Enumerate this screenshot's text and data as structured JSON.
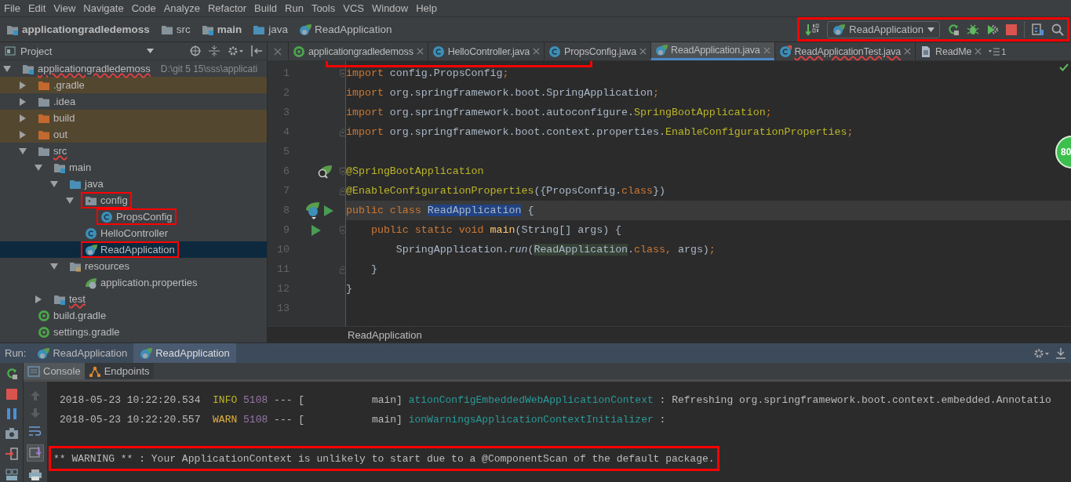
{
  "menu": [
    "File",
    "Edit",
    "View",
    "Navigate",
    "Code",
    "Analyze",
    "Refactor",
    "Build",
    "Run",
    "Tools",
    "VCS",
    "Window",
    "Help"
  ],
  "breadcrumbs": [
    {
      "label": "applicationgradledemoss",
      "kind": "module",
      "bold": true
    },
    {
      "label": "src",
      "kind": "folder",
      "bold": false
    },
    {
      "label": "main",
      "kind": "module",
      "bold": true
    },
    {
      "label": "java",
      "kind": "source",
      "bold": false
    },
    {
      "label": "ReadApplication",
      "kind": "spring-class",
      "bold": false
    }
  ],
  "run_toolbar": {
    "configuration": "ReadApplication",
    "highlighted": true
  },
  "project_panel": {
    "title": "Project",
    "tree": [
      {
        "name": "applicationgradledemoss",
        "path": "D:\\git 5 15\\sss\\applicati",
        "kind": "module",
        "expanded": true,
        "excluded": false,
        "selected": false,
        "highlighted": false,
        "errors": true,
        "children": [
          {
            "name": ".gradle",
            "kind": "folder",
            "expanded": false,
            "excluded": true,
            "selected": false,
            "highlighted": false,
            "errors": false
          },
          {
            "name": ".idea",
            "kind": "folder",
            "expanded": false,
            "excluded": false,
            "selected": false,
            "highlighted": false,
            "errors": false
          },
          {
            "name": "build",
            "kind": "folder",
            "expanded": false,
            "excluded": true,
            "selected": false,
            "highlighted": false,
            "errors": false
          },
          {
            "name": "out",
            "kind": "folder",
            "expanded": false,
            "excluded": true,
            "selected": false,
            "highlighted": false,
            "errors": false
          },
          {
            "name": "src",
            "kind": "folder",
            "expanded": true,
            "excluded": false,
            "selected": false,
            "highlighted": false,
            "errors": true,
            "children": [
              {
                "name": "main",
                "kind": "module",
                "expanded": true,
                "excluded": false,
                "selected": false,
                "highlighted": false,
                "errors": false,
                "children": [
                  {
                    "name": "java",
                    "kind": "source",
                    "expanded": true,
                    "excluded": false,
                    "selected": false,
                    "highlighted": false,
                    "errors": false,
                    "children": [
                      {
                        "name": "config",
                        "kind": "package",
                        "expanded": true,
                        "excluded": false,
                        "selected": false,
                        "highlighted": true,
                        "errors": false,
                        "children": [
                          {
                            "name": "PropsConfig",
                            "kind": "class",
                            "excluded": false,
                            "selected": false,
                            "highlighted": true,
                            "errors": false
                          }
                        ]
                      },
                      {
                        "name": "HelloController",
                        "kind": "class",
                        "excluded": false,
                        "selected": false,
                        "highlighted": false,
                        "errors": false
                      },
                      {
                        "name": "ReadApplication",
                        "kind": "spring-class",
                        "excluded": false,
                        "selected": true,
                        "highlighted": true,
                        "errors": false
                      }
                    ]
                  },
                  {
                    "name": "resources",
                    "kind": "resources",
                    "expanded": true,
                    "excluded": false,
                    "selected": false,
                    "highlighted": false,
                    "errors": false,
                    "children": [
                      {
                        "name": "application.properties",
                        "kind": "spring-props",
                        "excluded": false,
                        "selected": false,
                        "highlighted": false,
                        "errors": false
                      }
                    ]
                  }
                ]
              },
              {
                "name": "test",
                "kind": "module",
                "expanded": false,
                "excluded": false,
                "selected": false,
                "highlighted": false,
                "errors": true
              }
            ]
          },
          {
            "name": "build.gradle",
            "kind": "gradle",
            "excluded": false,
            "selected": false,
            "highlighted": false,
            "errors": false
          },
          {
            "name": "settings.gradle",
            "kind": "gradle",
            "excluded": false,
            "selected": false,
            "highlighted": false,
            "errors": false
          }
        ]
      }
    ]
  },
  "editor": {
    "highlight_frame": true,
    "tabs": [
      {
        "label": "applicationgradledemoss",
        "kind": "gradle",
        "selected": false,
        "errors": false
      },
      {
        "label": "HelloController.java",
        "kind": "class",
        "selected": false,
        "errors": false
      },
      {
        "label": "PropsConfig.java",
        "kind": "class",
        "selected": false,
        "errors": false
      },
      {
        "label": "ReadApplication.java",
        "kind": "spring-class",
        "selected": true,
        "errors": false
      },
      {
        "label": "ReadApplicationTest.java",
        "kind": "test-class",
        "selected": false,
        "errors": true
      },
      {
        "label": "ReadMe",
        "kind": "file",
        "selected": false,
        "errors": false
      }
    ],
    "tab_overflow": "1",
    "lines": [
      {
        "number": "1",
        "current": false,
        "marks": [
          {
            "kind": "fold-start"
          }
        ],
        "tokens": [
          {
            "text": "import",
            "kind": "kw"
          },
          {
            "text": " config.PropsConfig",
            "kind": "plain"
          },
          {
            "text": ";",
            "kind": "kw"
          }
        ]
      },
      {
        "number": "2",
        "current": false,
        "tokens": [
          {
            "text": "import",
            "kind": "kw"
          },
          {
            "text": " org.springframework.boot.SpringApplication",
            "kind": "plain"
          },
          {
            "text": ";",
            "kind": "kw"
          }
        ]
      },
      {
        "number": "3",
        "current": false,
        "tokens": [
          {
            "text": "import",
            "kind": "kw"
          },
          {
            "text": " org.springframework.boot.autoconfigure.",
            "kind": "plain"
          },
          {
            "text": "SpringBootApplication",
            "kind": "ann"
          },
          {
            "text": ";",
            "kind": "kw"
          }
        ]
      },
      {
        "number": "4",
        "current": false,
        "marks": [
          {
            "kind": "fold-end"
          }
        ],
        "tokens": [
          {
            "text": "import",
            "kind": "kw"
          },
          {
            "text": " org.springframework.boot.context.properties.",
            "kind": "plain"
          },
          {
            "text": "EnableConfigurationProperties",
            "kind": "ann"
          },
          {
            "text": ";",
            "kind": "kw"
          }
        ]
      },
      {
        "number": "5",
        "current": false
      },
      {
        "number": "6",
        "current": false,
        "marks": [
          {
            "kind": "bean"
          },
          {
            "kind": "fold-start"
          }
        ],
        "tokens": [
          {
            "text": "@SpringBootApplication",
            "kind": "ann"
          }
        ]
      },
      {
        "number": "7",
        "current": false,
        "marks": [
          {
            "kind": "fold-end"
          }
        ],
        "tokens": [
          {
            "text": "@EnableConfigurationProperties",
            "kind": "ann"
          },
          {
            "text": "({PropsConfig.",
            "kind": "plain"
          },
          {
            "text": "class",
            "kind": "kw"
          },
          {
            "text": "})",
            "kind": "plain"
          }
        ]
      },
      {
        "number": "8",
        "current": true,
        "marks": [
          {
            "kind": "class"
          },
          {
            "kind": "run"
          }
        ],
        "tokens": [
          {
            "text": "public class ",
            "kind": "kw"
          },
          {
            "text": "ReadApplication",
            "kind": "sel"
          },
          {
            "text": " {",
            "kind": "plain"
          }
        ]
      },
      {
        "number": "9",
        "current": false,
        "marks": [
          {
            "kind": "run"
          },
          {
            "kind": "fold-start"
          }
        ],
        "tokens": [
          {
            "text": "    public static void ",
            "kind": "kw"
          },
          {
            "text": "main",
            "kind": "fn"
          },
          {
            "text": "(String[] args) {",
            "kind": "plain"
          }
        ]
      },
      {
        "number": "10",
        "current": false,
        "tokens": [
          {
            "text": "        SpringApplication.",
            "kind": "plain"
          },
          {
            "text": "run",
            "kind": "it"
          },
          {
            "text": "(",
            "kind": "plain"
          },
          {
            "text": "ReadApplication",
            "kind": "ref"
          },
          {
            "text": ".",
            "kind": "plain"
          },
          {
            "text": "class, ",
            "kind": "kw"
          },
          {
            "text": "args)",
            "kind": "plain"
          },
          {
            "text": ";",
            "kind": "kw"
          }
        ]
      },
      {
        "number": "11",
        "current": false,
        "marks": [
          {
            "kind": "fold-end"
          }
        ],
        "tokens": [
          {
            "text": "    }",
            "kind": "plain"
          }
        ]
      },
      {
        "number": "12",
        "current": false,
        "tokens": [
          {
            "text": "}",
            "kind": "plain"
          }
        ]
      },
      {
        "number": "13",
        "current": false
      }
    ],
    "footer": "ReadApplication",
    "coverage_badge": "80"
  },
  "run_window": {
    "label": "Run:",
    "tabs": [
      {
        "label": "ReadApplication",
        "selected": false
      },
      {
        "label": "ReadApplication",
        "selected": true
      }
    ],
    "console_tabs": [
      {
        "label": "Console",
        "kind": "console",
        "selected": true
      },
      {
        "label": "Endpoints",
        "kind": "endpoints",
        "selected": false
      }
    ],
    "lines": [
      {
        "highlighted": false,
        "segments": [
          {
            "text": "2018-05-23 10:22:20.534  ",
            "kind": "plain"
          },
          {
            "text": "INFO",
            "kind": "info"
          },
          {
            "text": " 5108",
            "kind": "pid"
          },
          {
            "text": " --- [           main] ",
            "kind": "plain"
          },
          {
            "text": "ationConfigEmbeddedWebApplicationContext",
            "kind": "logger"
          },
          {
            "text": " : Refreshing org.springframework.boot.context.embedded.Annotatio",
            "kind": "plain"
          }
        ]
      },
      {
        "highlighted": false,
        "segments": [
          {
            "text": "2018-05-23 10:22:20.557  ",
            "kind": "plain"
          },
          {
            "text": "WARN",
            "kind": "warn"
          },
          {
            "text": " 5108",
            "kind": "pid"
          },
          {
            "text": " --- [           main] ",
            "kind": "plain"
          },
          {
            "text": "ionWarningsApplicationContextInitializer",
            "kind": "logger"
          },
          {
            "text": " :",
            "kind": "plain"
          }
        ]
      },
      {
        "highlighted": true,
        "segments": [
          {
            "text": "** WARNING ** : Your ApplicationContext is unlikely to start due to a @ComponentScan of the default package.",
            "kind": "plain"
          }
        ]
      }
    ]
  }
}
